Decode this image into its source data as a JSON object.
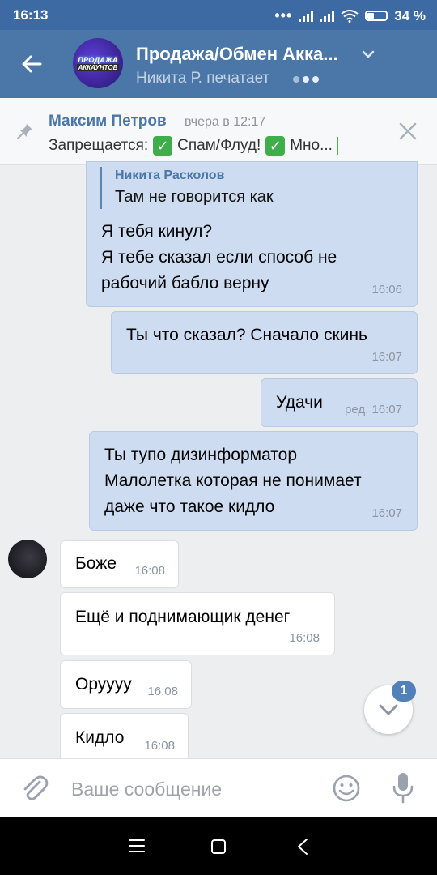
{
  "status_bar": {
    "time": "16:13",
    "battery": "34 %"
  },
  "header": {
    "title": "Продажа/Обмен Акка...",
    "subtitle": "Никита Р. печатает",
    "avatar_line1": "ПРОДАЖА",
    "avatar_line2": "АККАУНТОВ"
  },
  "pinned": {
    "author": "Максим Петров",
    "date": "вчера в 12:17",
    "text_prefix": "Запрещается:",
    "item1": "Спам/Флуд!",
    "item2": "Мно..."
  },
  "messages": [
    {
      "direction": "out",
      "reply_author": "Никита Расколов",
      "reply_text": "Там не говорится как",
      "lines": [
        "Я тебя кинул?",
        "Я тебе сказал если способ не",
        "рабочий бабло верну"
      ],
      "time": "16:06"
    },
    {
      "direction": "out",
      "lines": [
        "Ты что сказал? Сначало скинь"
      ],
      "time": "16:07"
    },
    {
      "direction": "out",
      "lines": [
        "Удачи"
      ],
      "time": "ред. 16:07"
    },
    {
      "direction": "out",
      "lines": [
        "Ты тупо дизинформатор",
        "Малолетка которая не понимает",
        "даже что такое кидло"
      ],
      "time": "16:07"
    },
    {
      "direction": "in",
      "lines": [
        "Боже"
      ],
      "time": "16:08"
    },
    {
      "direction": "in",
      "lines": [
        "Ещё и поднимающик денег"
      ],
      "time": "16:08"
    },
    {
      "direction": "in",
      "lines": [
        "Оруууу"
      ],
      "time": "16:08"
    },
    {
      "direction": "in",
      "lines": [
        "Кидло"
      ],
      "time": "16:08"
    }
  ],
  "scroll_badge": "1",
  "composer": {
    "placeholder": "Ваше сообщение"
  },
  "icons": {
    "back": "arrow-left-icon",
    "chevron": "chevron-down-icon",
    "pin": "pin-icon",
    "close": "close-icon",
    "attach": "paperclip-icon",
    "emoji": "smile-icon",
    "mic": "microphone-icon",
    "nav_menu": "menu-icon",
    "nav_home": "square-icon",
    "nav_back": "back-triangle-icon"
  },
  "colors": {
    "accent": "#4a76a8",
    "outgoing_bubble": "#cddcf0",
    "check_green": "#3fae4a"
  }
}
